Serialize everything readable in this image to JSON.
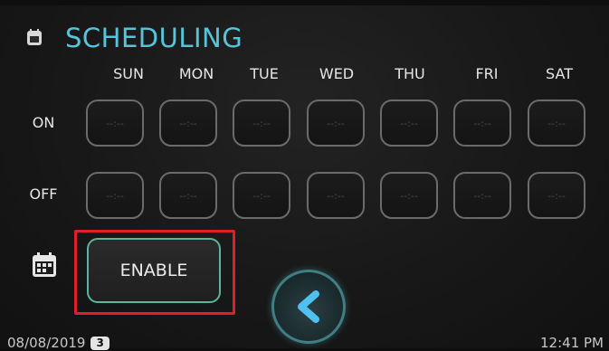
{
  "header": {
    "title": "SCHEDULING",
    "icon": "calendar-icon"
  },
  "days": [
    "SUN",
    "MON",
    "TUE",
    "WED",
    "THU",
    "FRI",
    "SAT"
  ],
  "rows": {
    "on": {
      "label": "ON",
      "values": [
        "--:--",
        "--:--",
        "--:--",
        "--:--",
        "--:--",
        "--:--",
        "--:--"
      ]
    },
    "off": {
      "label": "OFF",
      "values": [
        "--:--",
        "--:--",
        "--:--",
        "--:--",
        "--:--",
        "--:--",
        "--:--"
      ]
    }
  },
  "controls": {
    "enable_label": "ENABLE",
    "enable_icon": "calendar-grid-icon",
    "back_icon": "chevron-left-icon",
    "highlight_color": "#e01f27",
    "accent_color": "#56c5dc"
  },
  "status_bar": {
    "date": "08/08/2019",
    "badge": "3",
    "time": "12:41 PM"
  }
}
